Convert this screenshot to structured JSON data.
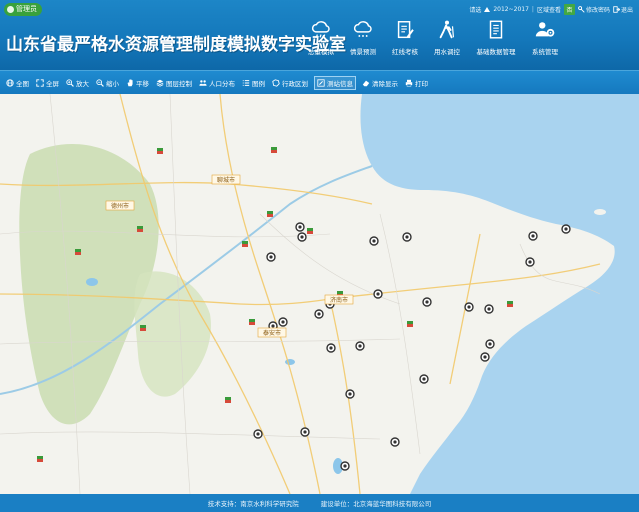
{
  "header": {
    "user_badge": "管理员",
    "title": "山东省最严格水资源管理制度模拟数字实验室",
    "status": {
      "label1": "请选",
      "date_range": "2012~2017",
      "label2": "区域查看",
      "badge": "否",
      "change_password": "修改密码",
      "exit": "退出"
    }
  },
  "nav": [
    {
      "label": "总量模拟",
      "icon": "cloud-rain-icon"
    },
    {
      "label": "情景预测",
      "icon": "cloud-snow-icon"
    },
    {
      "label": "红线考核",
      "icon": "document-pencil-icon"
    },
    {
      "label": "用水调控",
      "icon": "hiker-icon"
    },
    {
      "label": "基础数据管理",
      "icon": "document-list-icon"
    },
    {
      "label": "系统管理",
      "icon": "user-gear-icon"
    }
  ],
  "toolbar": [
    {
      "label": "全图",
      "icon": "globe-icon"
    },
    {
      "label": "全屏",
      "icon": "fullscreen-icon"
    },
    {
      "label": "放大",
      "icon": "zoom-in-icon"
    },
    {
      "label": "缩小",
      "icon": "zoom-out-icon"
    },
    {
      "label": "平移",
      "icon": "hand-icon"
    },
    {
      "label": "图层控制",
      "icon": "layers-icon"
    },
    {
      "label": "人口分布",
      "icon": "people-icon"
    },
    {
      "label": "图例",
      "icon": "legend-icon"
    },
    {
      "label": "行政区划",
      "icon": "boundary-icon"
    },
    {
      "label": "测站信息",
      "icon": "station-icon"
    },
    {
      "label": "清除显示",
      "icon": "eraser-icon"
    },
    {
      "label": "打印",
      "icon": "print-icon"
    }
  ],
  "footer": {
    "tech_support": "技术支持：南京水利科学研究院",
    "builder": "建设单位：北京海蓝华图科技有限公司"
  },
  "map": {
    "stations": 26,
    "city_labels": [
      "聊城市",
      "济南市",
      "德州市",
      "泰安市"
    ]
  }
}
